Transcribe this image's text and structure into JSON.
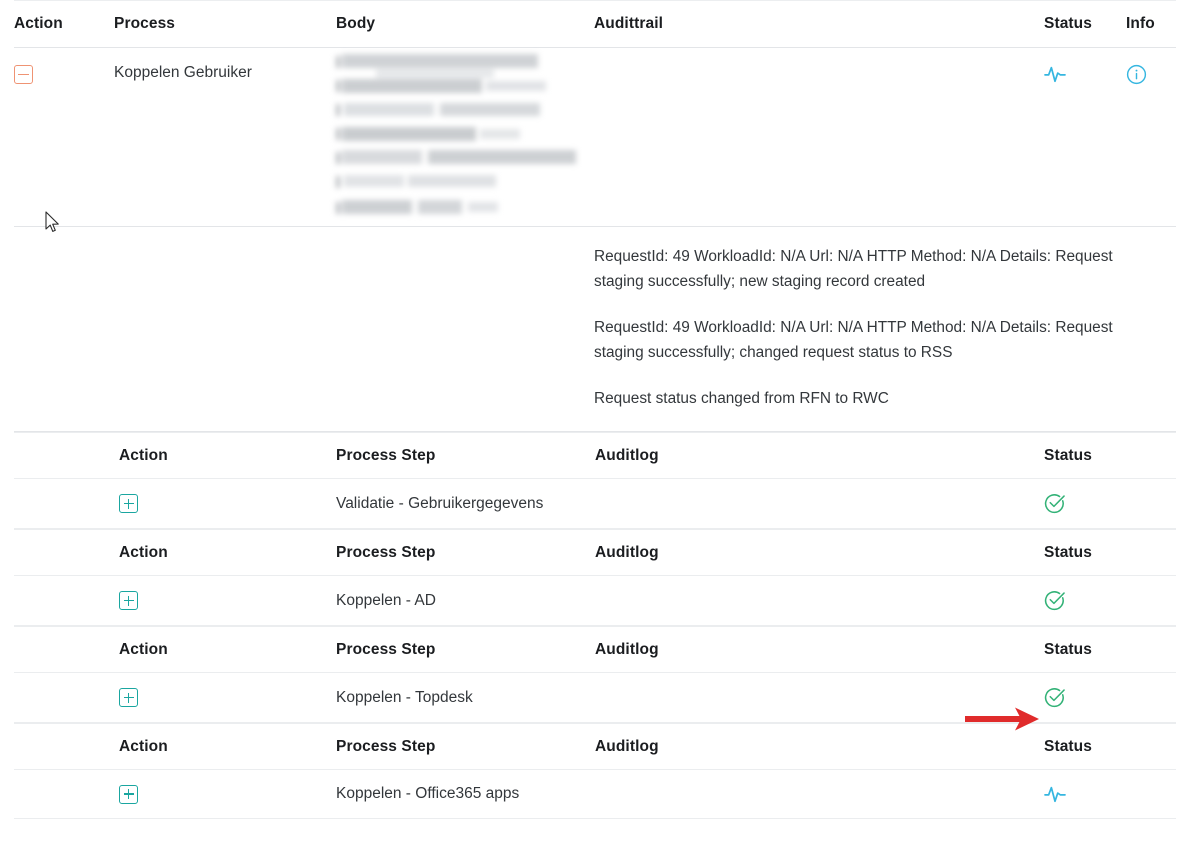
{
  "outer_table": {
    "columns": [
      "Action",
      "Process",
      "Body",
      "Audittrail",
      "Status",
      "Info"
    ],
    "row": {
      "action_icon": "minus-square-icon",
      "process": "Koppelen Gebruiker",
      "body": "",
      "audittrail": "",
      "status_icon": "activity-pulse-icon",
      "info_icon": "info-circle-icon"
    },
    "audittrail_row": {
      "entries": [
        "RequestId: 49 WorkloadId: N/A Url: N/A HTTP Method: N/A Details: Request staging successfully; new staging record created",
        "RequestId: 49 WorkloadId: N/A Url: N/A HTTP Method: N/A Details: Request staging successfully; changed request status to RSS",
        "Request status changed from RFN to RWC"
      ]
    }
  },
  "inner_tables": [
    {
      "columns": [
        "Action",
        "Process Step",
        "Auditlog",
        "Status"
      ],
      "row": {
        "action_icon": "plus-square-icon",
        "process_step": "Validatie - Gebruikergegevens",
        "auditlog": "",
        "status_icon": "check-circle-icon"
      }
    },
    {
      "columns": [
        "Action",
        "Process Step",
        "Auditlog",
        "Status"
      ],
      "row": {
        "action_icon": "plus-square-icon",
        "process_step": "Koppelen - AD",
        "auditlog": "",
        "status_icon": "check-circle-icon"
      }
    },
    {
      "columns": [
        "Action",
        "Process Step",
        "Auditlog",
        "Status"
      ],
      "row": {
        "action_icon": "plus-square-icon",
        "process_step": "Koppelen - Topdesk",
        "auditlog": "",
        "status_icon": "check-circle-icon",
        "annotation": "red-arrow-pointing-to-status"
      }
    },
    {
      "columns": [
        "Action",
        "Process Step",
        "Auditlog",
        "Status"
      ],
      "row": {
        "action_icon": "plus-square-icon",
        "process_step": "Koppelen - Office365 apps",
        "auditlog": "",
        "status_icon": "activity-pulse-icon"
      }
    }
  ],
  "colors": {
    "collapse_orange": "#ef9373",
    "expand_teal": "#1aa6a0",
    "status_pulse_blue": "#35b6e0",
    "status_check_green": "#33b277",
    "info_blue": "#35b6e0",
    "annotation_red": "#e02b2b",
    "border": "#e3e5e8",
    "text": "#33373b"
  }
}
